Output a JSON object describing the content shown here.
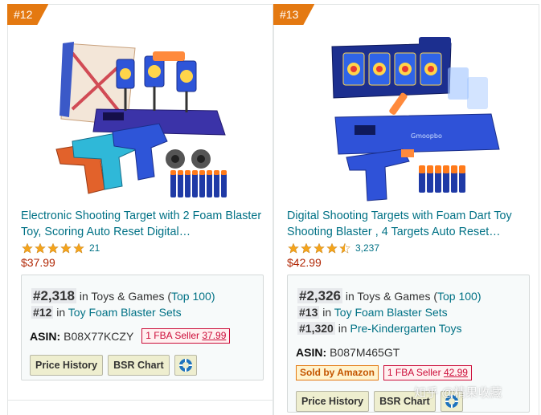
{
  "colors": {
    "badge": "#e47911",
    "link": "#007185",
    "price": "#b12704",
    "star": "#f4a41c",
    "fba": "#cc0c39",
    "button_bg": "#eeeecf"
  },
  "products": [
    {
      "rank_badge": "#12",
      "title": "Electronic Shooting Target with 2 Foam Blaster Toy, Scoring Auto Reset Digital…",
      "rating": 5,
      "review_count": "21",
      "price": "$37.99",
      "bsr": [
        {
          "rank": "#2,318",
          "in": "in Toys & Games (",
          "category": "Top 100",
          "close": ")"
        },
        {
          "rank": "#12",
          "in": "in",
          "category": "Toy Foam Blaster Sets"
        }
      ],
      "asin_label": "ASIN:",
      "asin": "B08X77KCZY",
      "fba_label": "1 FBA Seller",
      "fba_price": "37.99",
      "buttons": {
        "price_history": "Price History",
        "bsr_chart": "BSR Chart"
      },
      "image_icon": "blaster-target-product-image"
    },
    {
      "rank_badge": "#13",
      "title": "Digital Shooting Targets with Foam Dart Toy Shooting Blaster , 4 Targets Auto Reset…",
      "rating": 4.5,
      "review_count": "3,237",
      "price": "$42.99",
      "bsr": [
        {
          "rank": "#2,326",
          "in": "in Toys & Games (",
          "category": "Top 100",
          "close": ")"
        },
        {
          "rank": "#13",
          "in": "in",
          "category": "Toy Foam Blaster Sets"
        },
        {
          "rank": "#1,320",
          "in": "in",
          "category": "Pre-Kindergarten Toys"
        }
      ],
      "asin_label": "ASIN:",
      "asin": "B087M465GT",
      "sold_by": "Sold by Amazon",
      "fba_label": "1 FBA Seller",
      "fba_price": "42.99",
      "buttons": {
        "price_history": "Price History",
        "bsr_chart": "BSR Chart"
      },
      "image_icon": "digital-target-product-image"
    }
  ],
  "watermark": "知乎 @精果收藏"
}
